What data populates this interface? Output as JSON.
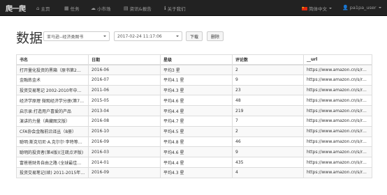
{
  "nav": {
    "brand": "爬一爬",
    "items": [
      {
        "icon": "home-icon",
        "glyph": "⌂",
        "label": "主页"
      },
      {
        "icon": "tasks-icon",
        "glyph": "▦",
        "label": "任务"
      },
      {
        "icon": "market-icon",
        "glyph": "☁",
        "label": "小市场"
      },
      {
        "icon": "news-icon",
        "glyph": "▤",
        "label": "资讯&报告"
      },
      {
        "icon": "info-icon",
        "glyph": "ℹ",
        "label": "关于我们"
      }
    ],
    "language": "简体中文",
    "user": "pa1pa_user"
  },
  "page": {
    "title": "数据",
    "source_select": "亚马逊--经济类图书",
    "time_select": "2017-02-24 11:17:06",
    "download_label": "下载",
    "delete_label": "删除"
  },
  "table": {
    "headers": [
      "书名",
      "日期",
      "星级",
      "评论数",
      "__url"
    ],
    "rows": [
      [
        "打开量化投资的黑箱（原书第2…",
        "2016-06",
        "平均3 星",
        "2",
        "https://www.amazon.cn/s/ref=sr…"
      ],
      [
        "金融炼金术",
        "2016-07",
        "平均4.1 星",
        "9",
        "https://www.amazon.cn/s/ref=sr…"
      ],
      [
        "投资交易笔记 2002-2010年中国…",
        "2011-06",
        "平均4.3 星",
        "23",
        "https://www.amazon.cn/s/ref=sr…"
      ],
      [
        "经济学原理 微观经济学分册(第7…",
        "2015-05",
        "平均4.6 星",
        "48",
        "https://www.amazon.cn/s/ref=sr…"
      ],
      [
        "启示录:打造用户喜爱的产品",
        "2013-04",
        "平均4.4 星",
        "219",
        "https://www.amazon.cn/s/ref=sr…"
      ],
      [
        "演讲的力量（典藏图文版）",
        "2016-08",
        "平均4.7 星",
        "7",
        "https://www.amazon.cn/s/ref=sr…"
      ],
      [
        "CFA协会金融前沿译丛（8册）",
        "2016-10",
        "平均4.5 星",
        "2",
        "https://www.amazon.cn/s/ref=sr…"
      ],
      [
        "聪明:斯克切尼·A.克尔尔·李特等等…",
        "2016-09",
        "平均4.8 星",
        "46",
        "https://www.amazon.cn/s/ref=sr…"
      ],
      [
        "聪明的投资者(第4版)(注疏点评版)",
        "2016-03",
        "平均4.6 星",
        "9",
        "https://www.amazon.cn/s/ref=sr…"
      ],
      [
        "富爸爸财务自由之路 (全球最佳…",
        "2014-01",
        "平均4.4 星",
        "435",
        "https://www.amazon.cn/s/ref=sr…"
      ],
      [
        "投资交易笔记(续) 2011-2015年…",
        "2016-09",
        "平均4.3 星",
        "4",
        "https://www.amazon.cn/s/ref=sr…"
      ]
    ]
  }
}
